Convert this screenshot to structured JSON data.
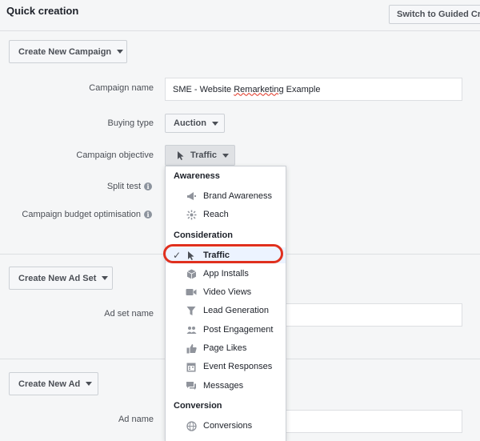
{
  "header": {
    "title": "Quick creation",
    "switch_label": "Switch to Guided Creation"
  },
  "campaign": {
    "create_label": "Create New Campaign",
    "name_label": "Campaign name",
    "name_value": "SME - Website Remarketing Example",
    "name_value_parts": [
      "SME - Website ",
      "Remarketing",
      " Example"
    ],
    "buying_type_label": "Buying type",
    "buying_type_value": "Auction",
    "objective_label": "Campaign objective",
    "objective_value": "Traffic",
    "split_test_label": "Split test",
    "budget_opt_label": "Campaign budget optimisation"
  },
  "adset": {
    "create_label": "Create New Ad Set",
    "name_label": "Ad set name"
  },
  "ad": {
    "create_label": "Create New Ad",
    "name_label": "Ad name"
  },
  "objective_menu": {
    "groups": [
      {
        "heading": "Awareness",
        "items": [
          {
            "label": "Brand Awareness",
            "icon": "megaphone-icon"
          },
          {
            "label": "Reach",
            "icon": "reach-icon"
          }
        ]
      },
      {
        "heading": "Consideration",
        "items": [
          {
            "label": "Traffic",
            "icon": "cursor-icon",
            "selected": true
          },
          {
            "label": "App Installs",
            "icon": "cube-icon"
          },
          {
            "label": "Video Views",
            "icon": "video-camera-icon"
          },
          {
            "label": "Lead Generation",
            "icon": "funnel-icon"
          },
          {
            "label": "Post Engagement",
            "icon": "people-icon"
          },
          {
            "label": "Page Likes",
            "icon": "thumbs-up-icon"
          },
          {
            "label": "Event Responses",
            "icon": "calendar-icon"
          },
          {
            "label": "Messages",
            "icon": "chat-bubble-icon"
          }
        ]
      },
      {
        "heading": "Conversion",
        "items": [
          {
            "label": "Conversions",
            "icon": "globe-icon"
          }
        ]
      }
    ]
  },
  "colors": {
    "highlight": "#e0301e",
    "selected_bg": "#ecf3ff",
    "background": "#f5f6f7"
  }
}
